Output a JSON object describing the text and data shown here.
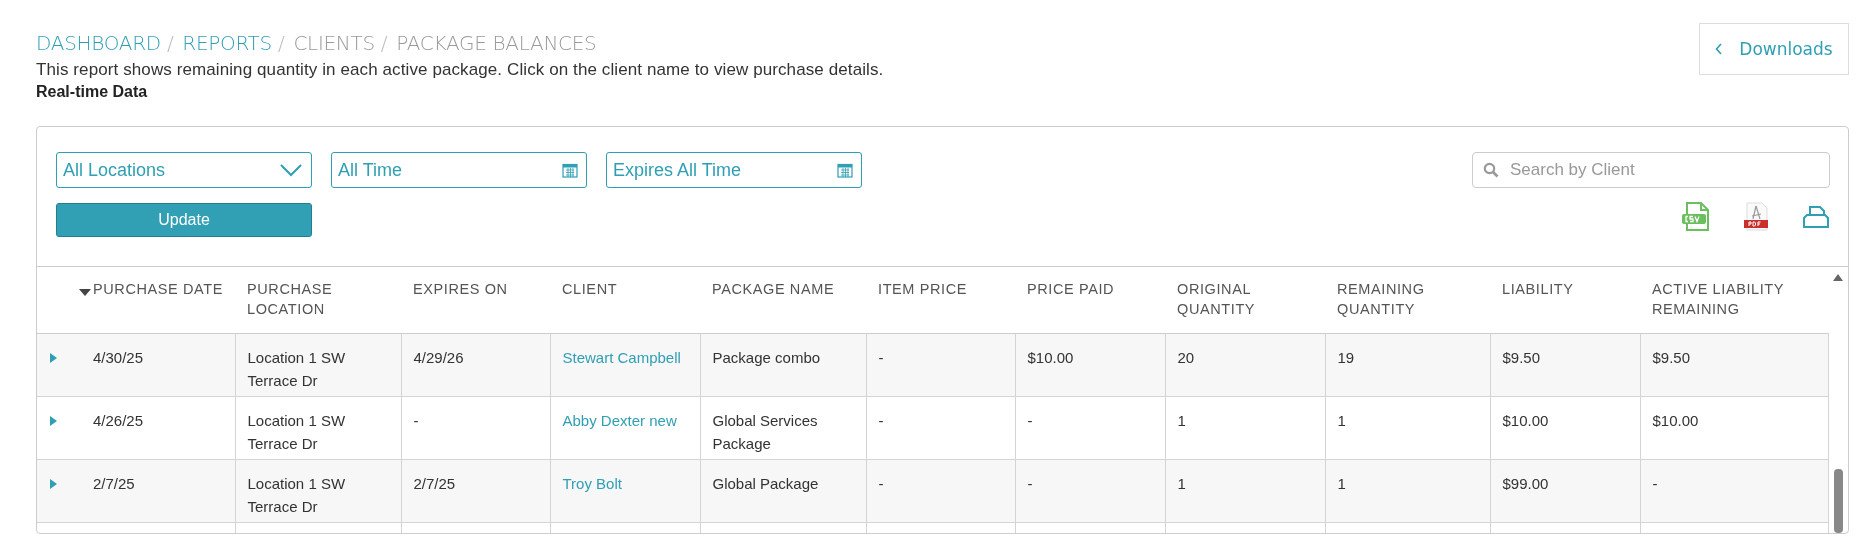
{
  "breadcrumb": [
    {
      "label": "DASHBOARD",
      "link": true
    },
    {
      "separator": "/",
      "label": "REPORTS",
      "link": true
    },
    {
      "separator": "/",
      "label": "CLIENTS",
      "link": false
    },
    {
      "separator": "/",
      "label": "PACKAGE BALANCES",
      "link": false
    }
  ],
  "description": "This report shows remaining quantity in each active package. Click on the client name to view purchase details.",
  "data_mode": "Real-time Data",
  "downloads_button": "Downloads",
  "filters": {
    "location": "All Locations",
    "purchase_range": "All Time",
    "expiry_range": "Expires All Time",
    "update_button": "Update",
    "search": {
      "placeholder": "Search by Client"
    }
  },
  "exports": [
    {
      "kind": "csv"
    },
    {
      "kind": "pdf"
    },
    {
      "kind": "print"
    }
  ],
  "table": {
    "columns": [
      {
        "label": "PURCHASE DATE",
        "sorted": true
      },
      {
        "label": "PURCHASE LOCATION",
        "sorted": false
      },
      {
        "label": "EXPIRES ON",
        "sorted": false
      },
      {
        "label": "CLIENT",
        "sorted": false
      },
      {
        "label": "PACKAGE NAME",
        "sorted": false
      },
      {
        "label": "ITEM PRICE",
        "sorted": false
      },
      {
        "label": "PRICE PAID",
        "sorted": false
      },
      {
        "label": "ORIGINAL QUANTITY",
        "sorted": false
      },
      {
        "label": "REMAINING QUANTITY",
        "sorted": false
      },
      {
        "label": "LIABILITY",
        "sorted": false
      },
      {
        "label": "ACTIVE LIABILITY REMAINING",
        "sorted": false
      }
    ],
    "rows": [
      {
        "expanded": false,
        "cells": [
          "4/30/25",
          "Location 1 SW Terrace Dr",
          "4/29/26",
          "Stewart Campbell",
          "Package combo",
          "-",
          "$10.00",
          "20",
          "19",
          "$9.50",
          "$9.50"
        ]
      },
      {
        "expanded": false,
        "cells": [
          "4/26/25",
          "Location 1 SW Terrace Dr",
          "-",
          "Abby Dexter new",
          "Global Services Package",
          "-",
          "-",
          "1",
          "1",
          "$10.00",
          "$10.00"
        ]
      },
      {
        "expanded": false,
        "cells": [
          "2/7/25",
          "Location 1 SW Terrace Dr",
          "2/7/25",
          "Troy Bolt",
          "Global Package",
          "-",
          "-",
          "1",
          "1",
          "$99.00",
          "-"
        ]
      }
    ]
  }
}
